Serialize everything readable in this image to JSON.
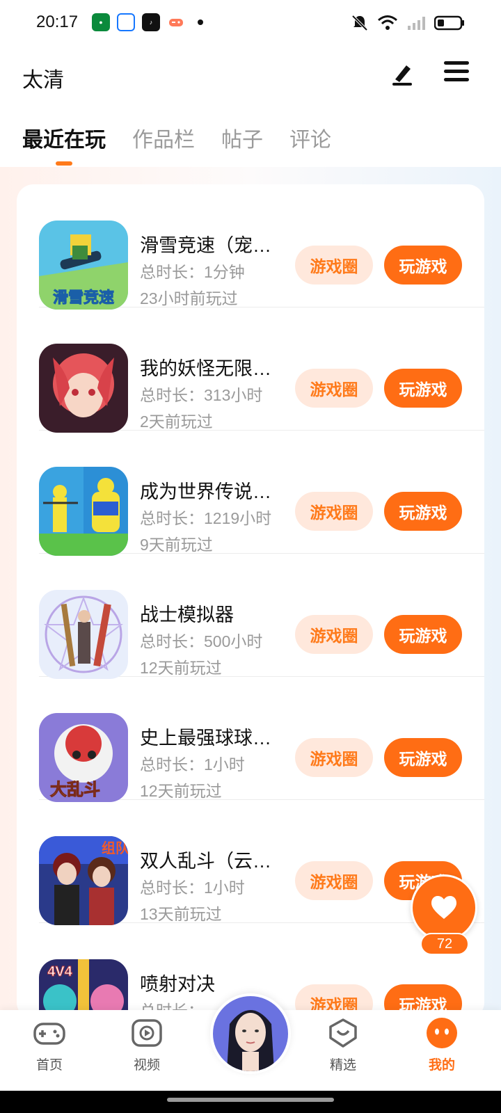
{
  "status_bar": {
    "time": "20:17",
    "app_icons": [
      "oppo-app-icon",
      "alipay-app-icon",
      "tiktok-app-icon",
      "game-app-icon"
    ],
    "indicators": [
      "mute-icon",
      "wifi-icon",
      "signal-icon",
      "battery-icon"
    ]
  },
  "header": {
    "username": "太清",
    "edit_icon": "edit-icon",
    "menu_icon": "menu-icon"
  },
  "tabs": [
    {
      "label": "最近在玩",
      "active": true
    },
    {
      "label": "作品栏",
      "active": false
    },
    {
      "label": "帖子",
      "active": false
    },
    {
      "label": "评论",
      "active": false
    }
  ],
  "games": [
    {
      "name": "滑雪竞速（宠物版）",
      "duration": "总时长：1分钟",
      "last_played": "23小时前玩过",
      "circle_label": "游戏圈",
      "play_label": "玩游戏"
    },
    {
      "name": "我的妖怪无限进化",
      "duration": "总时长：313小时",
      "last_played": "2天前玩过",
      "circle_label": "游戏圈",
      "play_label": "玩游戏"
    },
    {
      "name": "成为世界传说大力士",
      "duration": "总时长：1219小时",
      "last_played": "9天前玩过",
      "circle_label": "游戏圈",
      "play_label": "玩游戏"
    },
    {
      "name": "战士模拟器",
      "duration": "总时长：500小时",
      "last_played": "12天前玩过",
      "circle_label": "游戏圈",
      "play_label": "玩游戏"
    },
    {
      "name": "史上最强球球大乱斗",
      "duration": "总时长：1小时",
      "last_played": "12天前玩过",
      "circle_label": "游戏圈",
      "play_label": "玩游戏"
    },
    {
      "name": "双人乱斗（云游戏版）",
      "duration": "总时长：1小时",
      "last_played": "13天前玩过",
      "circle_label": "游戏圈",
      "play_label": "玩游戏"
    },
    {
      "name": "喷射对决",
      "duration": "总时长：",
      "last_played": "",
      "circle_label": "游戏圈",
      "play_label": "玩游戏"
    }
  ],
  "like_float": {
    "count": "72",
    "icon": "heart-icon"
  },
  "bottom_nav": {
    "items": [
      {
        "label": "首页",
        "icon": "gamepad-icon"
      },
      {
        "label": "视频",
        "icon": "play-video-icon"
      },
      {
        "label": "精选",
        "icon": "heart-box-icon"
      },
      {
        "label": "我的",
        "icon": "smile-face-icon",
        "active": true
      }
    ],
    "center_icon": "avatar-icon"
  },
  "colors": {
    "accent": "#ff6d14",
    "accent_light": "#ffe8dc",
    "text_primary": "#111111",
    "text_secondary": "#9a9a9a"
  }
}
